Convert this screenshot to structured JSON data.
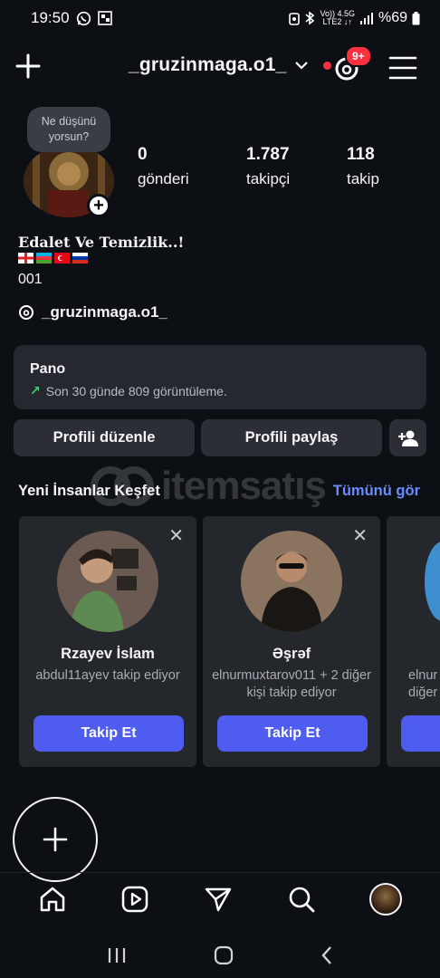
{
  "status_bar": {
    "time": "19:50",
    "net_top": "Vo)) 4.5G",
    "net_bottom": "LTE2 ↓↑",
    "battery": "%69"
  },
  "header": {
    "username": "_gruzinmaga.o1_",
    "notification_badge": "9+",
    "has_unread_dot": true
  },
  "profile": {
    "note_bubble": "Ne düşünü yorsun?",
    "stats": [
      {
        "value": "0",
        "label": "gönderi"
      },
      {
        "value": "1.787",
        "label": "takipçi"
      },
      {
        "value": "118",
        "label": "takip"
      }
    ],
    "bio_name": "Edalet Ve Temizlik..!",
    "bio_line3": "001",
    "threads_handle": "_gruzinmaga.o1_"
  },
  "dashboard": {
    "title": "Pano",
    "subtitle": "Son 30 günde 809 görüntüleme."
  },
  "actions": {
    "edit_profile": "Profili düzenle",
    "share_profile": "Profili paylaş"
  },
  "discover": {
    "title": "Yeni İnsanlar Keşfet",
    "see_all": "Tümünü gör",
    "cards": [
      {
        "name": "Rzayev İslam",
        "sub": "abdul11ayev takip ediyor",
        "button": "Takip Et"
      },
      {
        "name": "Əşrəf",
        "sub": "elnurmuxtarov011 + 2 diğer kişi takip ediyor",
        "button": "Takip Et"
      },
      {
        "name": "",
        "sub": "elnur diğer",
        "button": ""
      }
    ]
  },
  "watermark": {
    "text": "itemsatış"
  },
  "colors": {
    "background": "#0c0f14",
    "card": "#24272c",
    "accent_blue": "#4e5df0",
    "link_blue": "#6a8cff",
    "badge_red": "#ff3040",
    "trend_green": "#3fcf74"
  },
  "icons": {
    "bottom_nav": [
      "home-icon",
      "reels-icon",
      "send-icon",
      "search-icon",
      "profile-avatar"
    ]
  }
}
